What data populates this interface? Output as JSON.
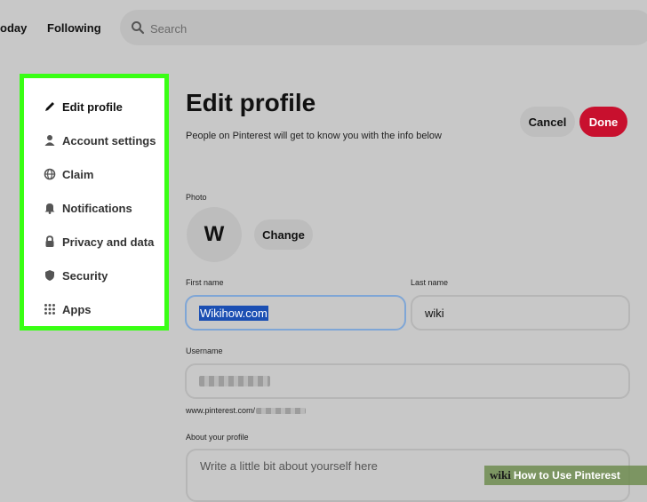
{
  "topnav": {
    "today_label": "oday",
    "following_label": "Following",
    "search_placeholder": "Search"
  },
  "sidebar": {
    "items": [
      {
        "label": "Edit profile",
        "icon": "pencil-icon",
        "active": true
      },
      {
        "label": "Account settings",
        "icon": "person-icon"
      },
      {
        "label": "Claim",
        "icon": "globe-icon"
      },
      {
        "label": "Notifications",
        "icon": "bell-icon"
      },
      {
        "label": "Privacy and data",
        "icon": "lock-icon"
      },
      {
        "label": "Security",
        "icon": "shield-icon"
      },
      {
        "label": "Apps",
        "icon": "grid-icon"
      }
    ],
    "highlight_color": "#39ff14"
  },
  "main": {
    "title": "Edit profile",
    "subtitle": "People on Pinterest will get to know you with the info below",
    "cancel_label": "Cancel",
    "done_label": "Done",
    "photo_label": "Photo",
    "avatar_initial": "W",
    "change_label": "Change",
    "first_name_label": "First name",
    "first_name_value": "Wikihow.com",
    "last_name_label": "Last name",
    "last_name_value": "wiki",
    "username_label": "Username",
    "url_prefix": "www.pinterest.com/",
    "about_label": "About your profile",
    "about_placeholder": "Write a little bit about yourself here"
  },
  "watermark": {
    "brand": "wiki",
    "text": "How to Use Pinterest"
  },
  "colors": {
    "accent_done": "#c8102e",
    "selection": "#1b4fb3",
    "focus_border": "#7fa6d6"
  }
}
